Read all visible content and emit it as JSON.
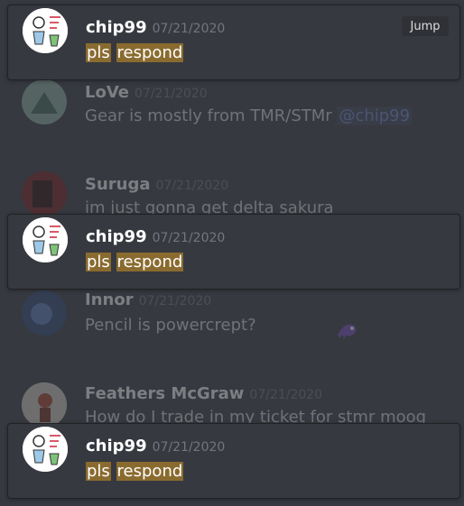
{
  "pinned_cards": [
    {
      "author": "chip99",
      "timestamp": "07/21/2020",
      "message_parts": [
        "pls",
        "respond"
      ],
      "jump_label": "Jump"
    },
    {
      "author": "chip99",
      "timestamp": "07/21/2020",
      "message_parts": [
        "pls",
        "respond"
      ]
    },
    {
      "author": "chip99",
      "timestamp": "07/21/2020",
      "message_parts": [
        "pls",
        "respond"
      ]
    }
  ],
  "messages": [
    {
      "author": "LoVe",
      "timestamp": "07/21/2020",
      "text": "Gear is mostly from TMR/STMr",
      "mention": "@chip99"
    },
    {
      "author": "Suruga",
      "timestamp": "07/21/2020",
      "text": "im just gonna get delta sakura"
    },
    {
      "author": "Innor",
      "timestamp": "07/21/2020",
      "text": "Pencil is powercrept?",
      "emoji": "dragon-emoji"
    },
    {
      "author": "Feathers McGraw",
      "timestamp": "07/21/2020",
      "text": "How do I trade in my ticket for stmr moog"
    }
  ],
  "colors": {
    "background": "#36393f",
    "highlight": "#8a6b2f",
    "mention": "#7289da",
    "timestamp": "#72767d"
  }
}
